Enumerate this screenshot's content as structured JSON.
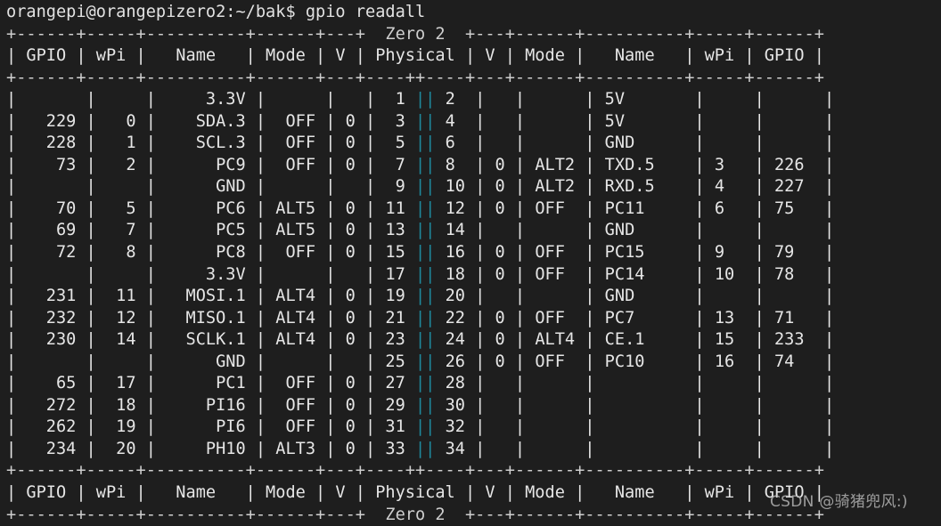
{
  "terminal": {
    "prompt": "orangepi@orangepizero2:~/bak$ ",
    "command": "gpio readall",
    "board_label": "Zero 2",
    "colors": {
      "background": "#1e1e1e",
      "foreground": "#d8d8d8",
      "rule": "#cfcfcf",
      "divider_teal": "#1f8a9e"
    }
  },
  "table": {
    "border_left": "+------+-----+----------+------+---+",
    "border_right": "+---+------+----------+-----+------+",
    "inner_left": "+------+-----+----------+------+---+----+",
    "inner_right": "+---+------+----------+-----+------+",
    "headers_left": [
      "GPIO",
      "wPi",
      "Name",
      "Mode",
      "V",
      "Physical"
    ],
    "headers_right": [
      "V",
      "Mode",
      "Name",
      "wPi",
      "GPIO"
    ],
    "rows": [
      {
        "gpio_l": "",
        "wpi_l": "",
        "name_l": "3.3V",
        "mode_l": "",
        "v_l": "",
        "phys_l": "1",
        "phys_r": "2",
        "v_r": "",
        "mode_r": "",
        "name_r": "5V",
        "wpi_r": "",
        "gpio_r": ""
      },
      {
        "gpio_l": "229",
        "wpi_l": "0",
        "name_l": "SDA.3",
        "mode_l": "OFF",
        "v_l": "0",
        "phys_l": "3",
        "phys_r": "4",
        "v_r": "",
        "mode_r": "",
        "name_r": "5V",
        "wpi_r": "",
        "gpio_r": ""
      },
      {
        "gpio_l": "228",
        "wpi_l": "1",
        "name_l": "SCL.3",
        "mode_l": "OFF",
        "v_l": "0",
        "phys_l": "5",
        "phys_r": "6",
        "v_r": "",
        "mode_r": "",
        "name_r": "GND",
        "wpi_r": "",
        "gpio_r": ""
      },
      {
        "gpio_l": "73",
        "wpi_l": "2",
        "name_l": "PC9",
        "mode_l": "OFF",
        "v_l": "0",
        "phys_l": "7",
        "phys_r": "8",
        "v_r": "0",
        "mode_r": "ALT2",
        "name_r": "TXD.5",
        "wpi_r": "3",
        "gpio_r": "226"
      },
      {
        "gpio_l": "",
        "wpi_l": "",
        "name_l": "GND",
        "mode_l": "",
        "v_l": "",
        "phys_l": "9",
        "phys_r": "10",
        "v_r": "0",
        "mode_r": "ALT2",
        "name_r": "RXD.5",
        "wpi_r": "4",
        "gpio_r": "227"
      },
      {
        "gpio_l": "70",
        "wpi_l": "5",
        "name_l": "PC6",
        "mode_l": "ALT5",
        "v_l": "0",
        "phys_l": "11",
        "phys_r": "12",
        "v_r": "0",
        "mode_r": "OFF",
        "name_r": "PC11",
        "wpi_r": "6",
        "gpio_r": "75"
      },
      {
        "gpio_l": "69",
        "wpi_l": "7",
        "name_l": "PC5",
        "mode_l": "ALT5",
        "v_l": "0",
        "phys_l": "13",
        "phys_r": "14",
        "v_r": "",
        "mode_r": "",
        "name_r": "GND",
        "wpi_r": "",
        "gpio_r": ""
      },
      {
        "gpio_l": "72",
        "wpi_l": "8",
        "name_l": "PC8",
        "mode_l": "OFF",
        "v_l": "0",
        "phys_l": "15",
        "phys_r": "16",
        "v_r": "0",
        "mode_r": "OFF",
        "name_r": "PC15",
        "wpi_r": "9",
        "gpio_r": "79"
      },
      {
        "gpio_l": "",
        "wpi_l": "",
        "name_l": "3.3V",
        "mode_l": "",
        "v_l": "",
        "phys_l": "17",
        "phys_r": "18",
        "v_r": "0",
        "mode_r": "OFF",
        "name_r": "PC14",
        "wpi_r": "10",
        "gpio_r": "78"
      },
      {
        "gpio_l": "231",
        "wpi_l": "11",
        "name_l": "MOSI.1",
        "mode_l": "ALT4",
        "v_l": "0",
        "phys_l": "19",
        "phys_r": "20",
        "v_r": "",
        "mode_r": "",
        "name_r": "GND",
        "wpi_r": "",
        "gpio_r": ""
      },
      {
        "gpio_l": "232",
        "wpi_l": "12",
        "name_l": "MISO.1",
        "mode_l": "ALT4",
        "v_l": "0",
        "phys_l": "21",
        "phys_r": "22",
        "v_r": "0",
        "mode_r": "OFF",
        "name_r": "PC7",
        "wpi_r": "13",
        "gpio_r": "71"
      },
      {
        "gpio_l": "230",
        "wpi_l": "14",
        "name_l": "SCLK.1",
        "mode_l": "ALT4",
        "v_l": "0",
        "phys_l": "23",
        "phys_r": "24",
        "v_r": "0",
        "mode_r": "ALT4",
        "name_r": "CE.1",
        "wpi_r": "15",
        "gpio_r": "233"
      },
      {
        "gpio_l": "",
        "wpi_l": "",
        "name_l": "GND",
        "mode_l": "",
        "v_l": "",
        "phys_l": "25",
        "phys_r": "26",
        "v_r": "0",
        "mode_r": "OFF",
        "name_r": "PC10",
        "wpi_r": "16",
        "gpio_r": "74"
      },
      {
        "gpio_l": "65",
        "wpi_l": "17",
        "name_l": "PC1",
        "mode_l": "OFF",
        "v_l": "0",
        "phys_l": "27",
        "phys_r": "28",
        "v_r": "",
        "mode_r": "",
        "name_r": "",
        "wpi_r": "",
        "gpio_r": ""
      },
      {
        "gpio_l": "272",
        "wpi_l": "18",
        "name_l": "PI16",
        "mode_l": "OFF",
        "v_l": "0",
        "phys_l": "29",
        "phys_r": "30",
        "v_r": "",
        "mode_r": "",
        "name_r": "",
        "wpi_r": "",
        "gpio_r": ""
      },
      {
        "gpio_l": "262",
        "wpi_l": "19",
        "name_l": "PI6",
        "mode_l": "OFF",
        "v_l": "0",
        "phys_l": "31",
        "phys_r": "32",
        "v_r": "",
        "mode_r": "",
        "name_r": "",
        "wpi_r": "",
        "gpio_r": ""
      },
      {
        "gpio_l": "234",
        "wpi_l": "20",
        "name_l": "PH10",
        "mode_l": "ALT3",
        "v_l": "0",
        "phys_l": "33",
        "phys_r": "34",
        "v_r": "",
        "mode_r": "",
        "name_r": "",
        "wpi_r": "",
        "gpio_r": ""
      }
    ]
  },
  "watermark": {
    "text": "CSDN @骑猪兜风:)"
  }
}
